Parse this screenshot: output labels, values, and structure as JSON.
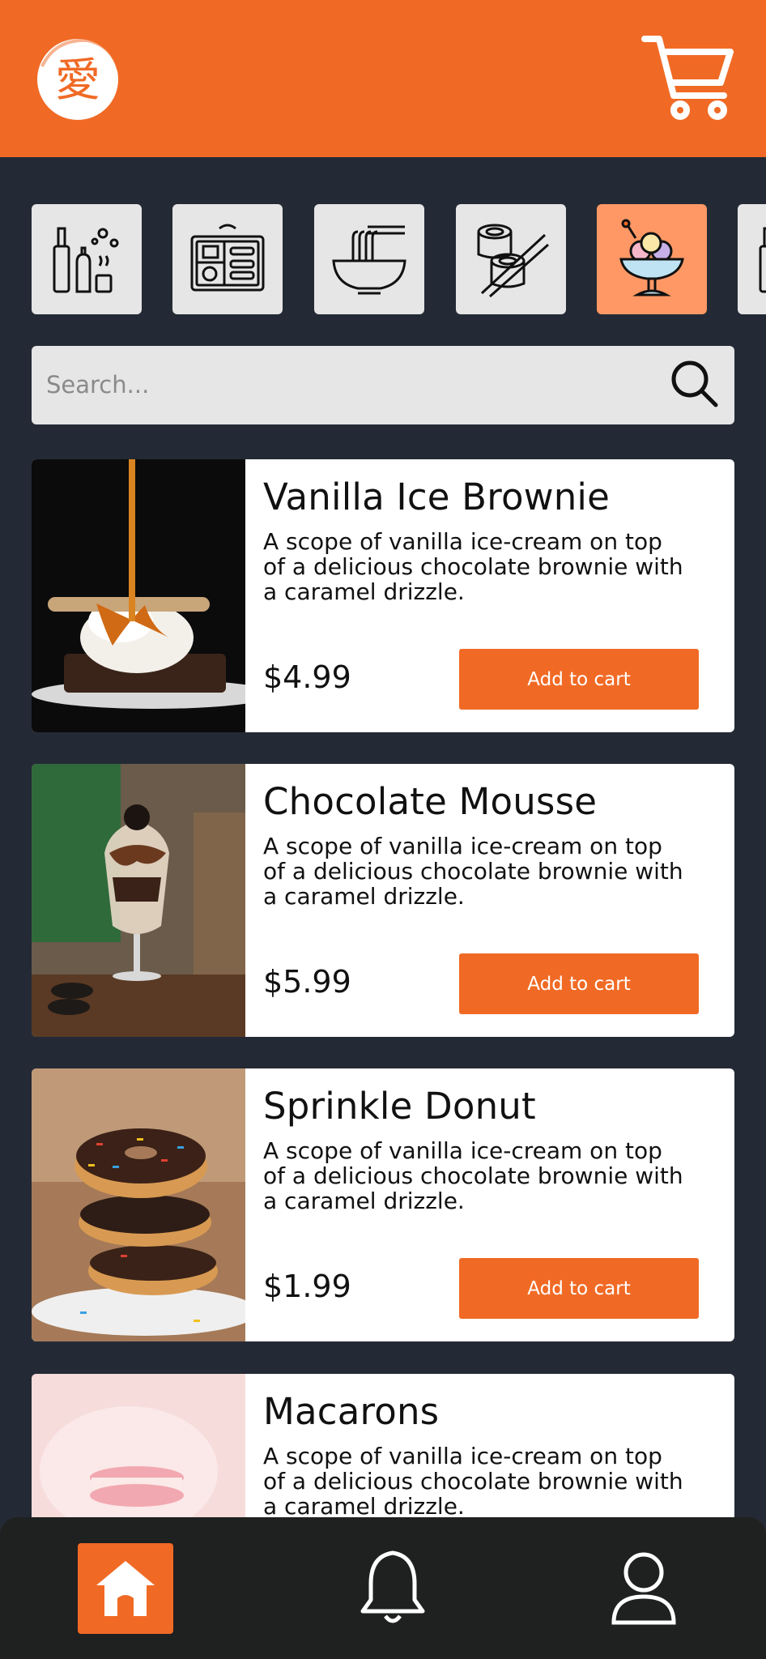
{
  "header": {
    "logo_icon": "kanji-logo-icon",
    "cart_icon": "shopping-cart-icon"
  },
  "categories": [
    {
      "icon": "sake-bottles-icon",
      "active": false
    },
    {
      "icon": "bento-box-icon",
      "active": false
    },
    {
      "icon": "noodle-bowl-icon",
      "active": false
    },
    {
      "icon": "sushi-roll-icon",
      "active": false
    },
    {
      "icon": "ice-cream-sundae-icon",
      "active": true
    },
    {
      "icon": "drink-bottle-icon",
      "active": false
    }
  ],
  "search": {
    "placeholder": "Search..."
  },
  "products": [
    {
      "title": "Vanilla Ice Brownie",
      "description": "A scope of vanilla ice-cream on top of a delicious chocolate brownie with a caramel drizzle.",
      "price": "$4.99",
      "button": "Add to cart"
    },
    {
      "title": "Chocolate Mousse",
      "description": "A scope of vanilla ice-cream on top of a delicious chocolate brownie with a caramel drizzle.",
      "price": "$5.99",
      "button": "Add to cart"
    },
    {
      "title": "Sprinkle Donut",
      "description": "A scope of vanilla ice-cream on top of a delicious chocolate brownie with a caramel drizzle.",
      "price": "$1.99",
      "button": "Add to cart"
    },
    {
      "title": "Macarons",
      "description": "A scope of vanilla ice-cream on top of a delicious chocolate brownie with a caramel drizzle."
    }
  ],
  "nav": {
    "home_icon": "home-icon",
    "bell_icon": "bell-icon",
    "user_icon": "user-icon"
  },
  "colors": {
    "accent": "#f06a25",
    "background": "#242a35",
    "active_category": "#ff9865"
  }
}
